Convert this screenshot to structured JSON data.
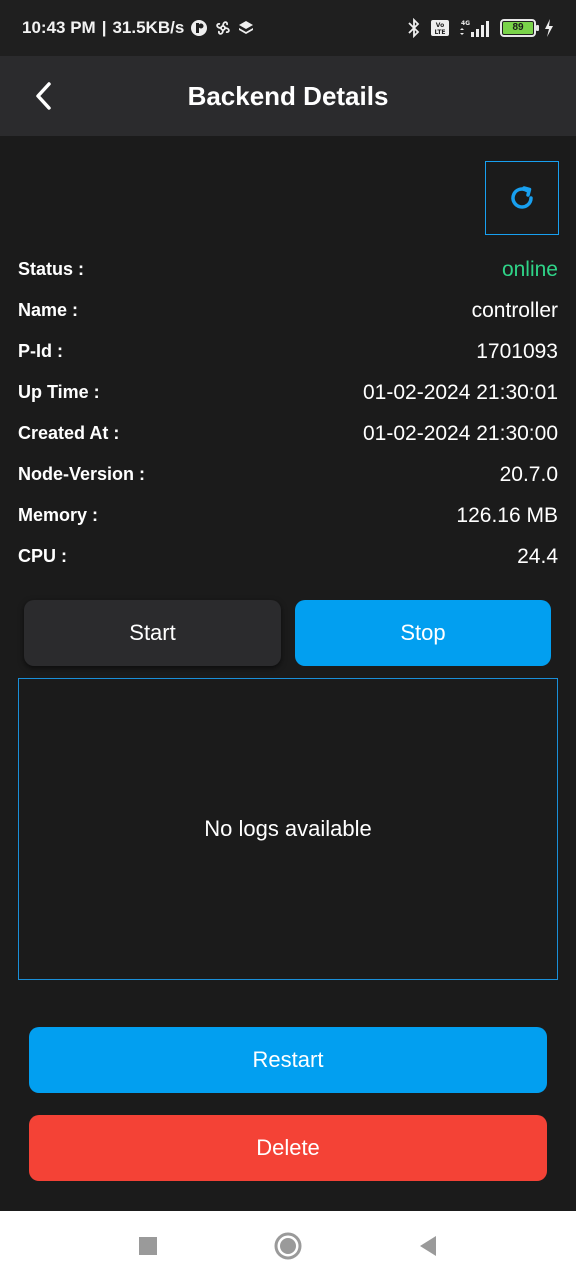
{
  "status_bar": {
    "time": "10:43 PM",
    "separator": "|",
    "speed": "31.5KB/s",
    "network": "4G",
    "volte": "Vo LTE",
    "battery": "89"
  },
  "app_bar": {
    "title": "Backend Details"
  },
  "details": [
    {
      "label": "Status :",
      "value": "online"
    },
    {
      "label": "Name :",
      "value": "controller"
    },
    {
      "label": "P-Id :",
      "value": "1701093"
    },
    {
      "label": "Up Time :",
      "value": "01-02-2024 21:30:01"
    },
    {
      "label": "Created At :",
      "value": "01-02-2024 21:30:00"
    },
    {
      "label": "Node-Version :",
      "value": "20.7.0"
    },
    {
      "label": "Memory :",
      "value": "126.16 MB"
    },
    {
      "label": "CPU :",
      "value": "24.4"
    }
  ],
  "actions": {
    "start": "Start",
    "stop": "Stop",
    "restart": "Restart",
    "delete": "Delete"
  },
  "logs": {
    "empty_text": "No logs available"
  },
  "colors": {
    "accent": "#029ff0",
    "online": "#2fd488",
    "danger": "#f44236",
    "background": "#1b1b1b",
    "surface": "#2b2b2d"
  },
  "icons": {
    "back": "chevron-left-icon",
    "refresh": "refresh-icon",
    "bluetooth": "bluetooth-icon",
    "signal": "signal-icon",
    "battery": "battery-icon",
    "charging": "charging-icon",
    "nav_recents": "square-icon",
    "nav_home": "circle-icon",
    "nav_back": "triangle-back-icon"
  }
}
